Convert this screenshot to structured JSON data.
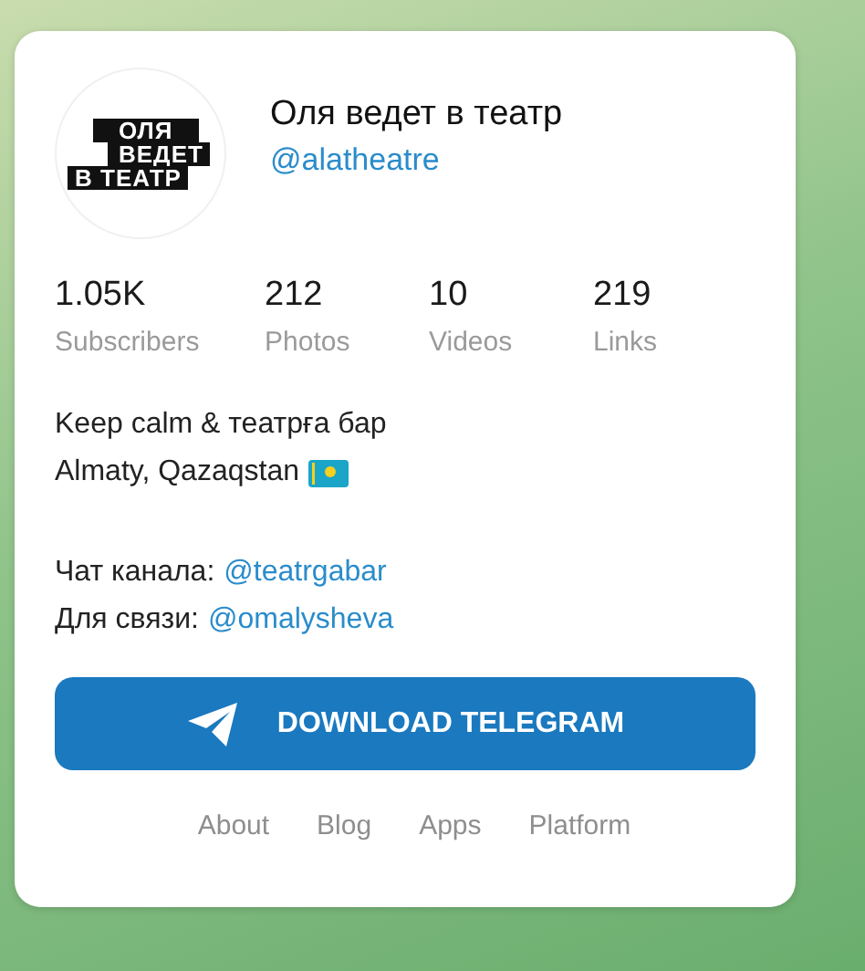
{
  "channel": {
    "avatar_lines": [
      "ОЛЯ",
      "ВЕДЕТ",
      "В ТЕАТР"
    ],
    "name": "Оля ведет в театр",
    "username": "@alatheatre"
  },
  "stats": [
    {
      "value": "1.05K",
      "label": "Subscribers"
    },
    {
      "value": "212",
      "label": "Photos"
    },
    {
      "value": "10",
      "label": "Videos"
    },
    {
      "value": "219",
      "label": "Links"
    }
  ],
  "bio": [
    {
      "text": "Keep calm & театрға бар",
      "flag": false
    },
    {
      "text": "Almaty, Qazaqstan",
      "flag": true
    },
    {
      "text": "Чат канала:",
      "link": "@teatrgabar",
      "flag": false
    },
    {
      "text": "Для связи:",
      "link": "@omalysheva",
      "flag": false
    }
  ],
  "button": {
    "label": "DOWNLOAD TELEGRAM"
  },
  "footer_links": [
    "About",
    "Blog",
    "Apps",
    "Platform"
  ]
}
